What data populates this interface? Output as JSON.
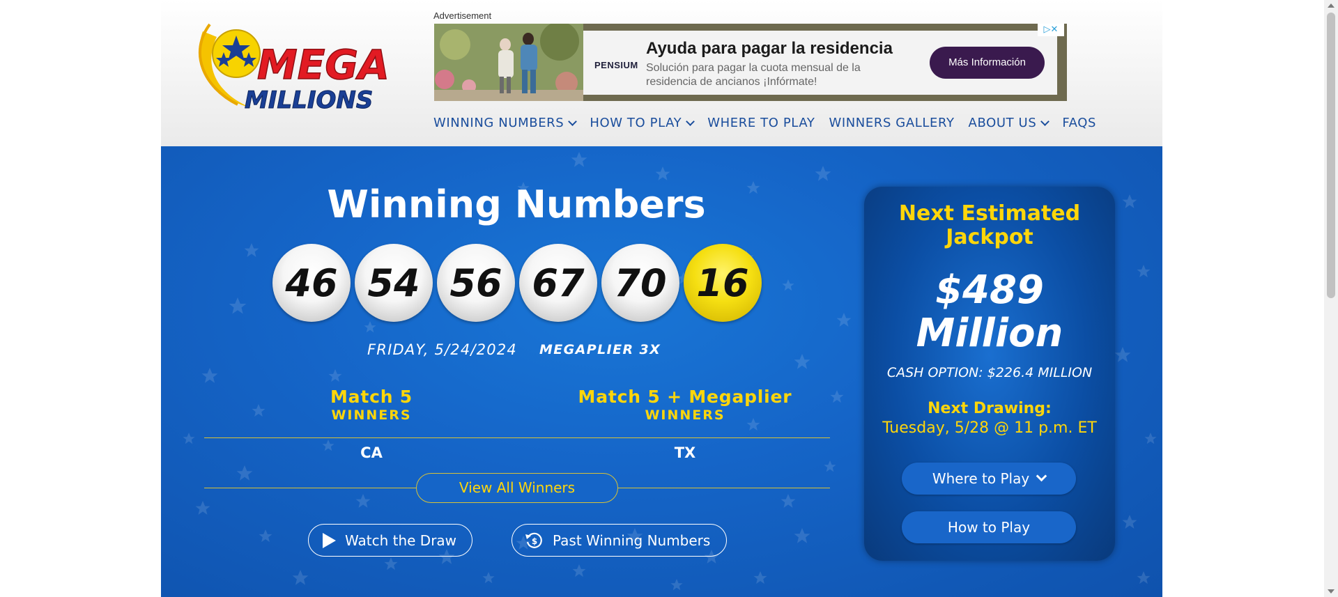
{
  "logo": {
    "alt": "Mega Millions",
    "line1": "MEGA",
    "line2": "MILLIONS"
  },
  "ad": {
    "label": "Advertisement",
    "brand": "PENSIUM",
    "headline": "Ayuda para pagar la residencia",
    "body": "Solución para pagar la cuota mensual de la residencia de ancianos ¡Infórmate!",
    "cta": "Más Información"
  },
  "nav": {
    "items": [
      {
        "label": "WINNING NUMBERS",
        "dropdown": true
      },
      {
        "label": "HOW TO PLAY",
        "dropdown": true
      },
      {
        "label": "WHERE TO PLAY",
        "dropdown": false
      },
      {
        "label": "WINNERS GALLERY",
        "dropdown": false
      },
      {
        "label": "ABOUT US",
        "dropdown": true
      },
      {
        "label": "FAQS",
        "dropdown": false
      }
    ]
  },
  "hero": {
    "title": "Winning Numbers",
    "balls": [
      "46",
      "54",
      "56",
      "67",
      "70"
    ],
    "mega_ball": "16",
    "draw_date": "FRIDAY, 5/24/2024",
    "megaplier": "MEGAPLIER 3X",
    "winners": {
      "col1_title": "Match 5",
      "col1_sub": "WINNERS",
      "col1_value": "CA",
      "col2_title": "Match 5 + Megaplier",
      "col2_sub": "WINNERS",
      "col2_value": "TX"
    },
    "view_all": "View All Winners",
    "watch_draw": "Watch the Draw",
    "past_numbers": "Past Winning Numbers"
  },
  "jackpot": {
    "heading_line1": "Next Estimated",
    "heading_line2": "Jackpot",
    "amount_line1": "$489",
    "amount_line2": "Million",
    "cash_option": "CASH OPTION: $226.4 MILLION",
    "next_drawing_label": "Next Drawing:",
    "next_drawing_date": "Tuesday, 5/28 @ 11 p.m. ET",
    "where_to_play": "Where to Play",
    "how_to_play": "How to Play"
  },
  "colors": {
    "nav_text": "#1a4d9c",
    "hero_blue": "#1565c8",
    "gold": "#ffd60a",
    "mega_ball": "#f5df12"
  }
}
